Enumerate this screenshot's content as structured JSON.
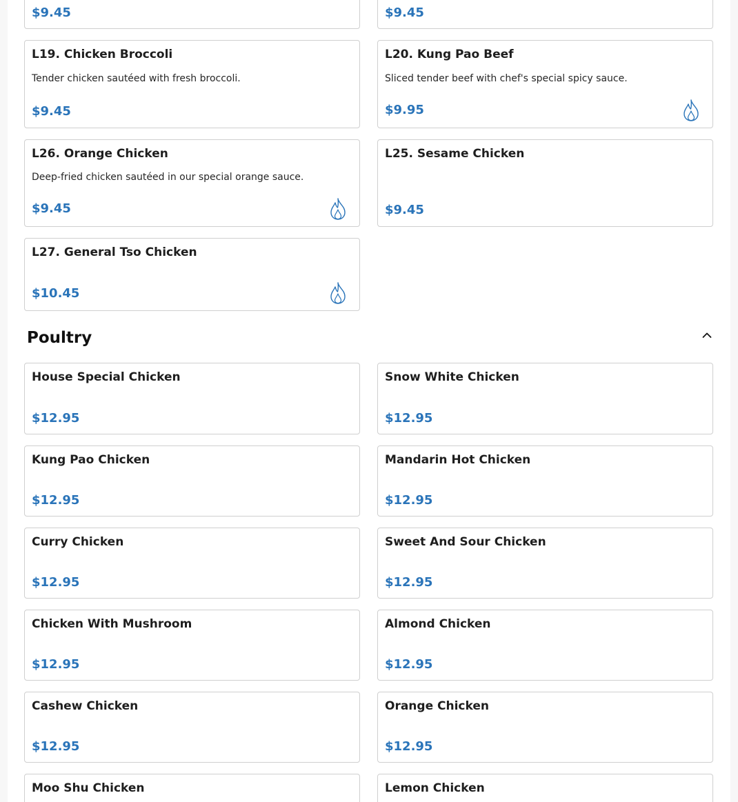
{
  "lunch_items": [
    {
      "price": "$9.45"
    },
    {
      "price": "$9.45"
    },
    {
      "name": "L19. Chicken Broccoli",
      "description": "Tender chicken sautéed with fresh broccoli.",
      "price": "$9.45",
      "spicy": false
    },
    {
      "name": "L20. Kung Pao Beef",
      "description": "Sliced tender beef with chef's special spicy sauce.",
      "price": "$9.95",
      "spicy": true
    },
    {
      "name": "L26. Orange Chicken",
      "description": "Deep-fried chicken sautéed in our special orange sauce.",
      "price": "$9.45",
      "spicy": true
    },
    {
      "name": "L25. Sesame Chicken",
      "description": "",
      "price": "$9.45",
      "spicy": false
    },
    {
      "name": "L27. General Tso Chicken",
      "description": "",
      "price": "$10.45",
      "spicy": true
    }
  ],
  "poultry": {
    "title": "Poultry",
    "collapse_icon": "chevron-up-icon",
    "items": [
      {
        "name": "House Special Chicken",
        "price": "$12.95"
      },
      {
        "name": "Snow White Chicken",
        "price": "$12.95"
      },
      {
        "name": "Kung Pao Chicken",
        "price": "$12.95"
      },
      {
        "name": "Mandarin Hot Chicken",
        "price": "$12.95"
      },
      {
        "name": "Curry Chicken",
        "price": "$12.95"
      },
      {
        "name": "Sweet And Sour Chicken",
        "price": "$12.95"
      },
      {
        "name": "Chicken With Mushroom",
        "price": "$12.95"
      },
      {
        "name": "Almond Chicken",
        "price": "$12.95"
      },
      {
        "name": "Cashew Chicken",
        "price": "$12.95"
      },
      {
        "name": "Orange Chicken",
        "price": "$12.95"
      },
      {
        "name": "Moo Shu Chicken"
      },
      {
        "name": "Lemon Chicken"
      }
    ]
  },
  "colors": {
    "price": "#2a74b9",
    "spicy_icon": "#2a74b9",
    "card_border": "#cfcfcf"
  }
}
